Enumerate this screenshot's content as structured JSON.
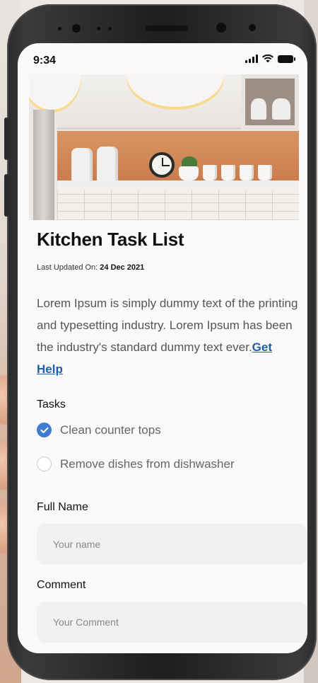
{
  "status_bar": {
    "time": "9:34"
  },
  "hero_image": {
    "description_icon": "kitchen-photo"
  },
  "page": {
    "title": "Kitchen Task List",
    "updated_prefix": "Last Updated On: ",
    "updated_date": "24 Dec 2021",
    "description": "Lorem Ipsum is simply dummy text of the printing and typesetting industry. Lorem Ipsum has been the industry's standard dummy text ever.",
    "help_link": "Get Help"
  },
  "tasks": {
    "label": "Tasks",
    "items": [
      {
        "label": "Clean counter tops",
        "checked": true
      },
      {
        "label": "Remove dishes from dishwasher",
        "checked": false
      }
    ]
  },
  "form": {
    "full_name_label": "Full Name",
    "full_name_placeholder": "Your name",
    "full_name_value": "",
    "comment_label": "Comment",
    "comment_placeholder": "Your Comment",
    "comment_value": ""
  },
  "colors": {
    "accent": "#3e7bd1",
    "link": "#1f5ea8",
    "field_bg": "#f1f1f1"
  }
}
